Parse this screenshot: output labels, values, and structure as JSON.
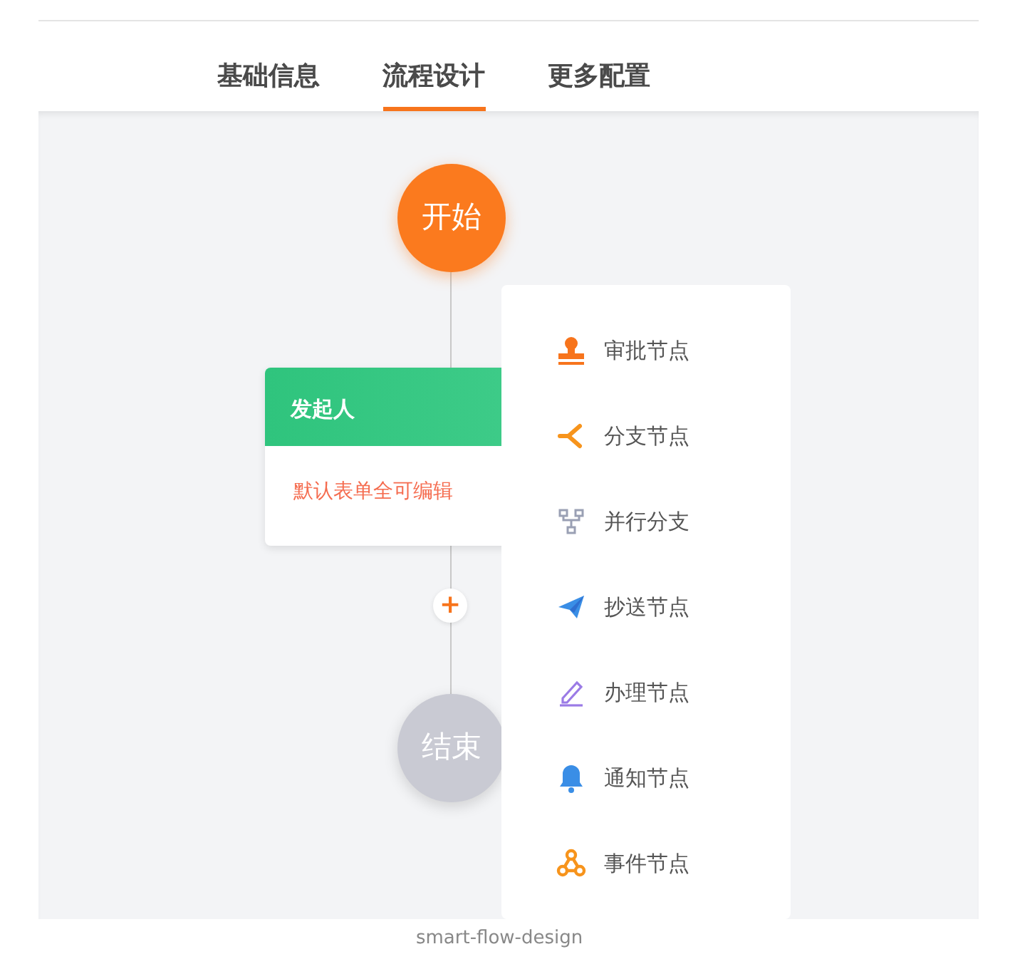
{
  "tabs": [
    {
      "label": "基础信息",
      "selected": false
    },
    {
      "label": "流程设计",
      "selected": true
    },
    {
      "label": "更多配置",
      "selected": false
    }
  ],
  "flow": {
    "start": "开始",
    "nodes": [
      {
        "title": "发起人",
        "content": "默认表单全可编辑"
      }
    ],
    "add_button": "+",
    "end": "结束"
  },
  "menu": {
    "items": [
      {
        "label": "审批节点",
        "kind": "approval"
      },
      {
        "label": "分支节点",
        "kind": "branch"
      },
      {
        "label": "并行分支",
        "kind": "parallel"
      },
      {
        "label": "抄送节点",
        "kind": "copy"
      },
      {
        "label": "办理节点",
        "kind": "handle"
      },
      {
        "label": "通知节点",
        "kind": "notify"
      },
      {
        "label": "事件节点",
        "kind": "event"
      }
    ]
  },
  "caption": "smart-flow-design"
}
